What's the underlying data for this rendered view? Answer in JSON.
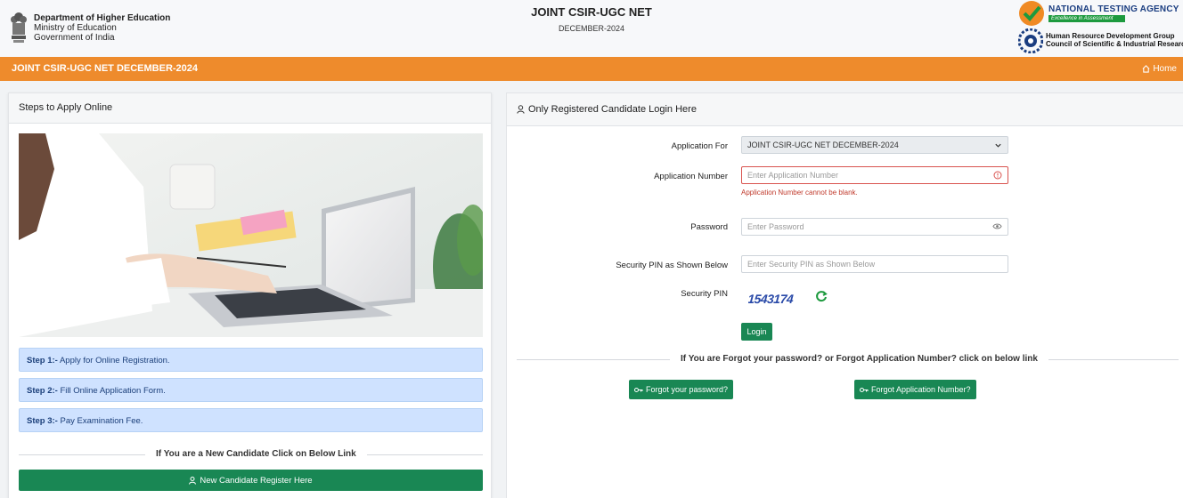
{
  "header": {
    "dept_line1": "Department of Higher Education",
    "dept_line2": "Ministry of Education",
    "dept_line3": "Government of India",
    "title": "JOINT CSIR-UGC NET",
    "subtitle": "DECEMBER-2024",
    "nta_name": "NATIONAL TESTING AGENCY",
    "nta_tagline": "Excellence in Assessment",
    "hrd_line1": "Human Resource Development Group",
    "hrd_line2": "Council of Scientific & Industrial Research"
  },
  "orange_bar": {
    "title": "JOINT CSIR-UGC NET DECEMBER-2024",
    "home_label": "Home"
  },
  "left": {
    "heading": "Steps to Apply Online",
    "steps": [
      {
        "label": "Step 1:-",
        "text": " Apply for Online Registration."
      },
      {
        "label": "Step 2:-",
        "text": " Fill Online Application Form."
      },
      {
        "label": "Step 3:-",
        "text": " Pay Examination Fee."
      }
    ],
    "new_candidate_text": "If You are a New Candidate Click on Below Link",
    "register_button": "New Candidate Register Here"
  },
  "right": {
    "heading": "Only Registered Candidate Login Here",
    "application_for_label": "Application For",
    "application_for_value": "JOINT CSIR-UGC NET DECEMBER-2024",
    "application_number_label": "Application Number",
    "application_number_placeholder": "Enter Application Number",
    "application_number_error": "Application Number cannot be blank.",
    "password_label": "Password",
    "password_placeholder": "Enter Password",
    "security_pin_input_label": "Security PIN as Shown Below",
    "security_pin_placeholder": "Enter Security PIN as Shown Below",
    "security_pin_label": "Security PIN",
    "captcha_value": "1543174",
    "login_button": "Login",
    "forgot_text": "If You are Forgot your password? or Forgot Application Number? click on below link",
    "forgot_password_button": "Forgot your password?",
    "forgot_appno_button": "Forgot Application Number?"
  },
  "colors": {
    "orange": "#ee8b2c",
    "green": "#198754",
    "step_bg": "#cfe2ff",
    "error": "#c0392b"
  }
}
